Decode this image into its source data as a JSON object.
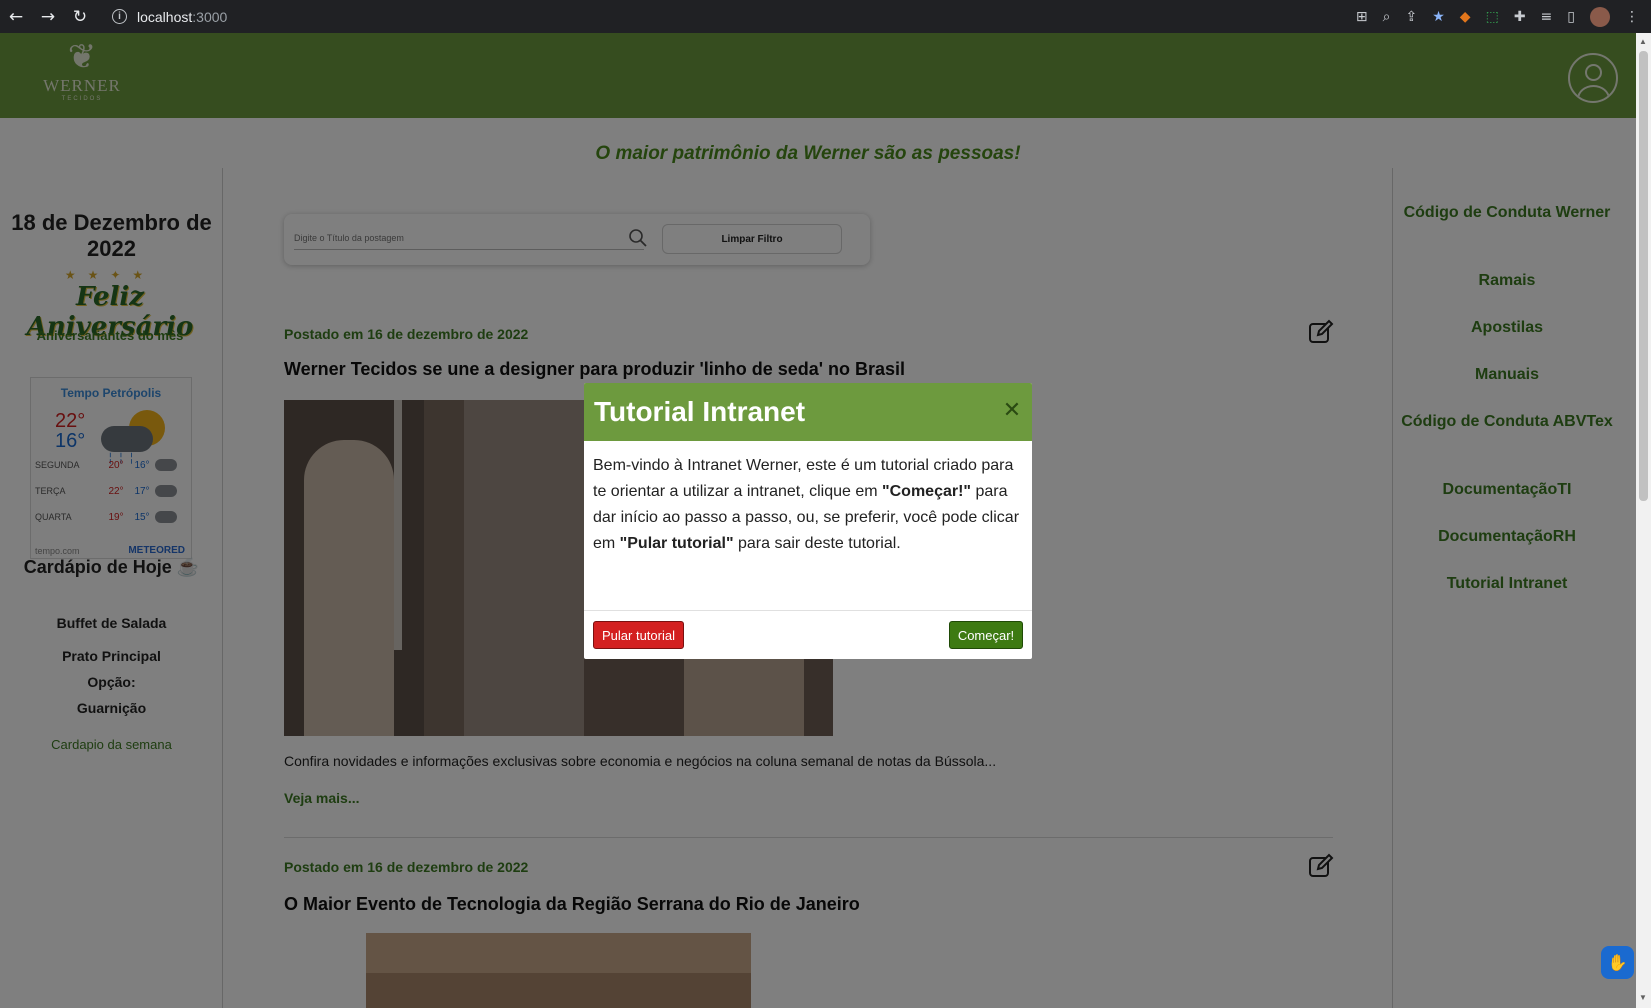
{
  "browser": {
    "url_host": "localhost",
    "url_port": ":3000",
    "back_icon": "arrow-left-icon",
    "forward_icon": "arrow-right-icon",
    "reload_icon": "reload-icon"
  },
  "header": {
    "logo_mark": "❦",
    "logo_name": "WERNER",
    "logo_sub": "TECIDOS",
    "slogan": "O maior patrimônio da Werner são as pessoas!"
  },
  "left": {
    "date": "18 de Dezembro de 2022",
    "birthday_title": "Feliz Aniversário",
    "birthday_subtitle": "Aniversariantes do mês",
    "weather": {
      "city": "Tempo Petrópolis",
      "today_max": "22°",
      "today_min": "16°",
      "days": [
        {
          "day": "SEGUNDA",
          "max": "20°",
          "min": "16°"
        },
        {
          "day": "TERÇA",
          "max": "22°",
          "min": "17°"
        },
        {
          "day": "QUARTA",
          "max": "19°",
          "min": "15°"
        }
      ],
      "source": "tempo.com",
      "brand": "METEORED"
    },
    "cardapio_title": "Cardápio de Hoje",
    "menu": [
      "Buffet de Salada",
      "Prato Principal",
      "Opção:",
      "Guarnição"
    ],
    "cardapio_link": "Cardapio da semana"
  },
  "search": {
    "placeholder": "Digite o Título da postagem",
    "clear_label": "Limpar Filtro"
  },
  "posts": [
    {
      "date": "Postado em 16 de dezembro de 2022",
      "title": "Werner Tecidos se une a designer para produzir 'linho de seda' no Brasil",
      "excerpt": "Confira novidades e informações exclusivas sobre economia e negócios na coluna semanal de notas da Bússola...",
      "more": "Veja mais..."
    },
    {
      "date": "Postado em 16 de dezembro de 2022",
      "title": "O Maior Evento de Tecnologia da Região Serrana do Rio de Janeiro"
    }
  ],
  "right": {
    "links": [
      "Código de Conduta Werner",
      "Ramais",
      "Apostilas",
      "Manuais",
      "Código de Conduta ABVTex",
      "DocumentaçãoTI",
      "DocumentaçãoRH",
      "Tutorial Intranet"
    ]
  },
  "modal": {
    "title": "Tutorial Intranet",
    "body_1": "Bem-vindo à Intranet Werner, este é um tutorial criado para te orientar a utilizar a intranet, clique em ",
    "body_bold_1": "\"Começar!\"",
    "body_2": " para dar início ao passo a passo, ou, se preferir, você pode clicar em ",
    "body_bold_2": "\"Pular tutorial\"",
    "body_3": " para sair deste tutorial.",
    "skip_label": "Pular tutorial",
    "start_label": "Começar!"
  },
  "colors": {
    "brand_green": "#6d9a3e",
    "link_green": "#3d7a22",
    "danger": "#d32020"
  }
}
